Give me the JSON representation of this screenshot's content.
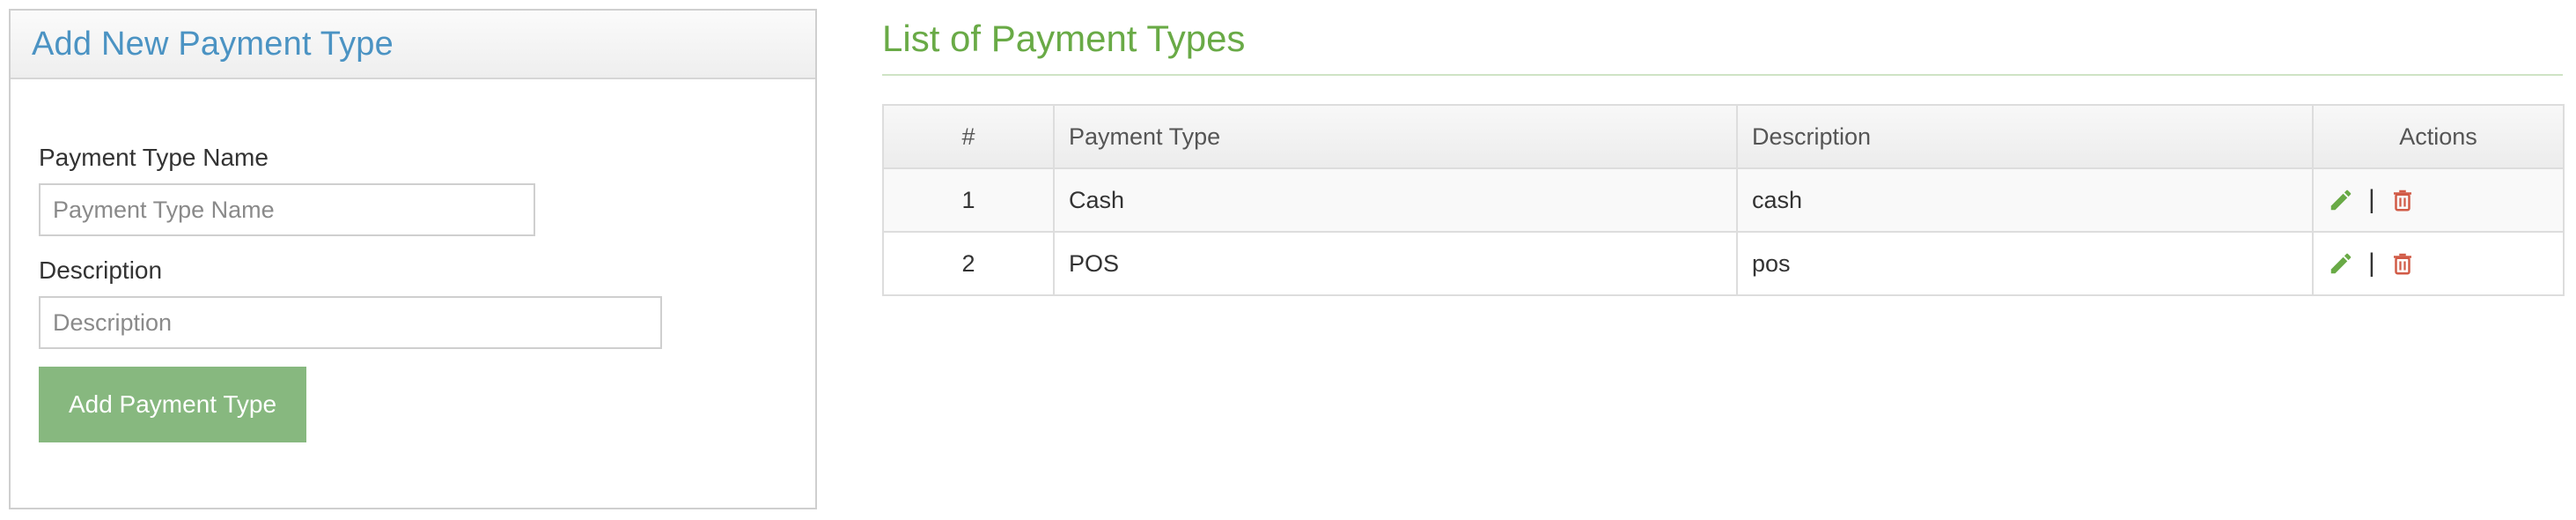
{
  "left_panel": {
    "title": "Add New Payment Type",
    "name_label": "Payment Type Name",
    "name_placeholder": "Payment Type Name",
    "name_value": "",
    "description_label": "Description",
    "description_placeholder": "Description",
    "description_value": "",
    "submit_label": "Add Payment Type"
  },
  "list": {
    "title": "List of Payment Types",
    "columns": [
      "#",
      "Payment Type",
      "Description",
      "Actions"
    ],
    "rows": [
      {
        "num": "1",
        "type": "Cash",
        "description": "cash",
        "separator": "|"
      },
      {
        "num": "2",
        "type": "POS",
        "description": "pos",
        "separator": "|"
      }
    ]
  },
  "icons": {
    "edit": "pencil-icon",
    "delete": "trash-icon"
  },
  "colors": {
    "panel_title": "#4b93c3",
    "list_title": "#69aa46",
    "button_bg": "#87b87f",
    "edit_icon": "#69aa46",
    "delete_icon": "#d15b47"
  }
}
